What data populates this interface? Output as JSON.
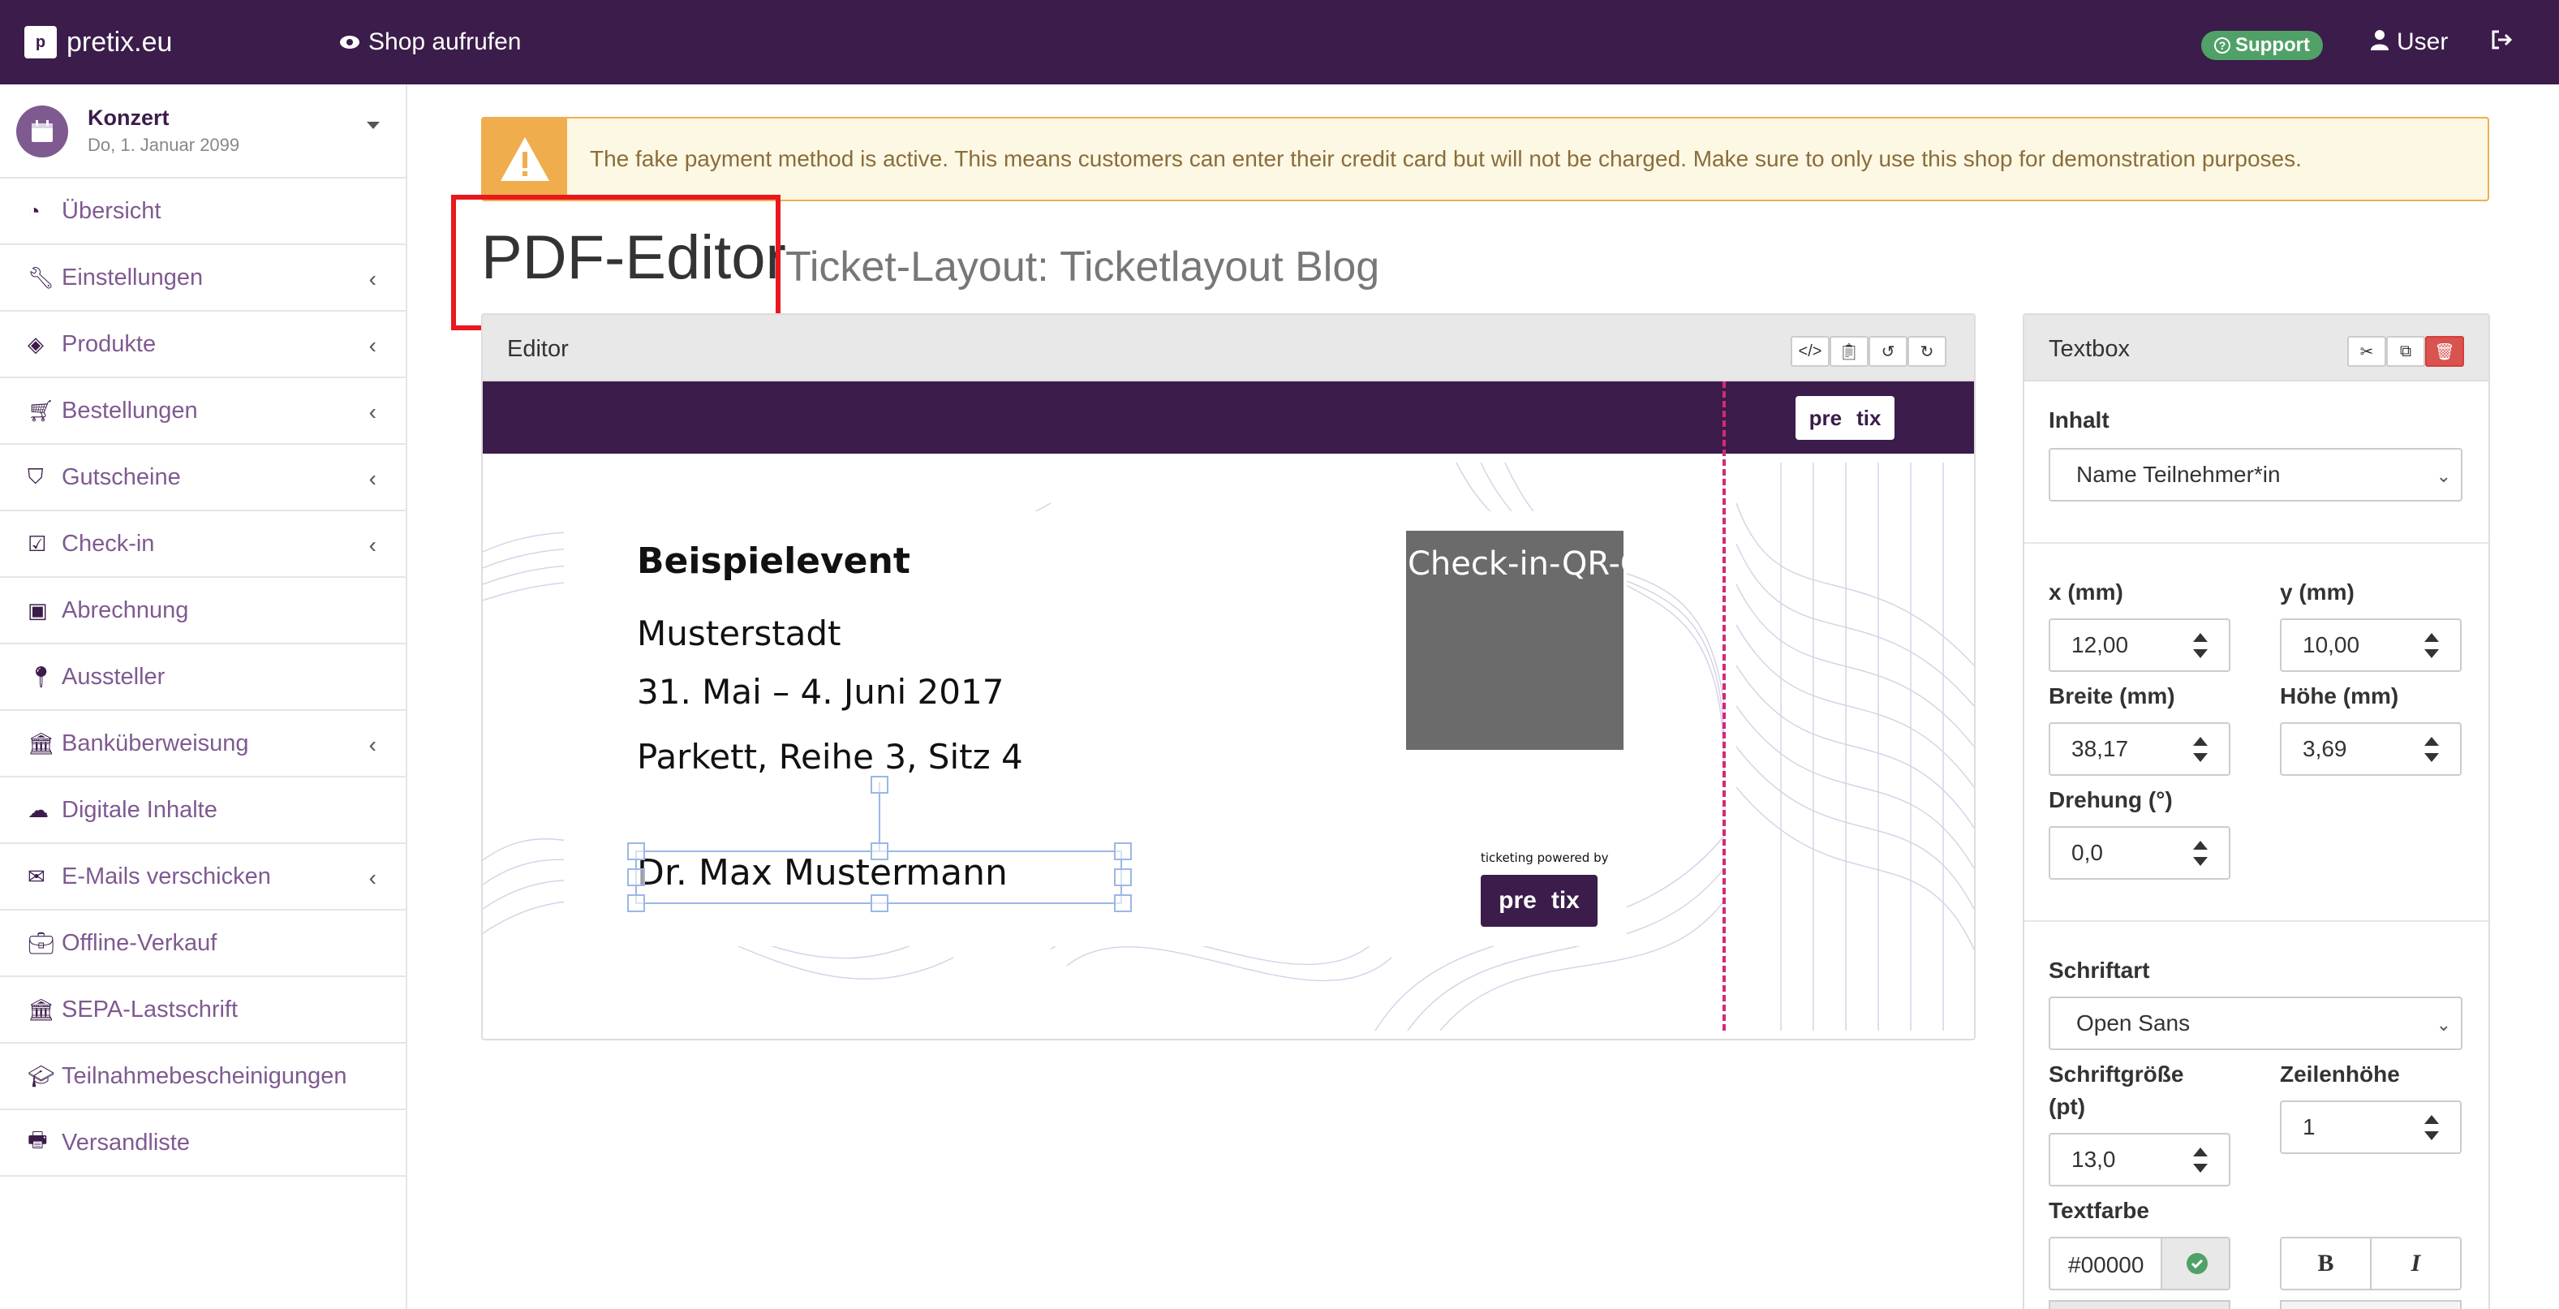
{
  "navbar": {
    "brand": "pretix.eu",
    "shop_link": "Shop aufrufen",
    "support": "Support",
    "user": "User"
  },
  "sidebar": {
    "event_name": "Konzert",
    "event_date": "Do, 1. Januar 2099",
    "items": [
      {
        "label": "Übersicht",
        "icon": "dashboard-icon"
      },
      {
        "label": "Einstellungen",
        "icon": "wrench-icon"
      },
      {
        "label": "Produkte",
        "icon": "ticket-icon"
      },
      {
        "label": "Bestellungen",
        "icon": "cart-icon"
      },
      {
        "label": "Gutscheine",
        "icon": "tags-icon"
      },
      {
        "label": "Check-in",
        "icon": "check-square-icon"
      },
      {
        "label": "Abrechnung",
        "icon": "money-icon"
      },
      {
        "label": "Aussteller",
        "icon": "map-pin-icon"
      },
      {
        "label": "Banküberweisung",
        "icon": "bank-icon"
      },
      {
        "label": "Digitale Inhalte",
        "icon": "cloud-icon"
      },
      {
        "label": "E-Mails verschicken",
        "icon": "envelope-icon"
      },
      {
        "label": "Offline-Verkauf",
        "icon": "briefcase-icon"
      },
      {
        "label": "SEPA-Lastschrift",
        "icon": "bank-icon"
      },
      {
        "label": "Teilnahmebescheinigungen",
        "icon": "graduation-cap-icon"
      },
      {
        "label": "Versandliste",
        "icon": "print-icon"
      }
    ]
  },
  "alert": {
    "text": "The fake payment method is active. This means customers can enter their credit card but will not be charged. Make sure to only use this shop for demonstration purposes."
  },
  "page": {
    "title": "PDF-Editor",
    "subtitle": "Ticket-Layout: Ticketlayout Blog"
  },
  "editor": {
    "heading": "Editor",
    "ticket": {
      "event": "Beispielevent",
      "city": "Musterstadt",
      "dates": "31. Mai – 4. Juni 2017",
      "seat": "Parkett, Reihe 3, Sitz 4",
      "attendee": "Dr. Max Mustermann",
      "qr_placeholder": "Check-in-QR-C",
      "powered_by": "ticketing powered by",
      "logo_left": "pre",
      "logo_right": "tix"
    }
  },
  "textbox": {
    "heading": "Textbox",
    "content_label": "Inhalt",
    "content_value": "Name Teilnehmer*in",
    "x_label": "x (mm)",
    "x_value": "12,00",
    "y_label": "y (mm)",
    "y_value": "10,00",
    "width_label": "Breite (mm)",
    "width_value": "38,17",
    "height_label": "Höhe (mm)",
    "height_value": "3,69",
    "rotation_label": "Drehung (°)",
    "rotation_value": "0,0",
    "font_label": "Schriftart",
    "font_value": "Open Sans",
    "size_label_1": "Schriftgröße",
    "size_label_2": "(pt)",
    "size_value": "13,0",
    "lineheight_label": "Zeilenhöhe",
    "lineheight_value": "1",
    "color_label": "Textfarbe",
    "color_value": "#00000",
    "bold": "B",
    "italic": "I"
  },
  "colors": {
    "brand": "#3b1c4a",
    "link": "#7f5a91",
    "warning": "#f0ad4e",
    "danger": "#d9534f",
    "success": "#50a167",
    "perforation": "#d4297a"
  }
}
